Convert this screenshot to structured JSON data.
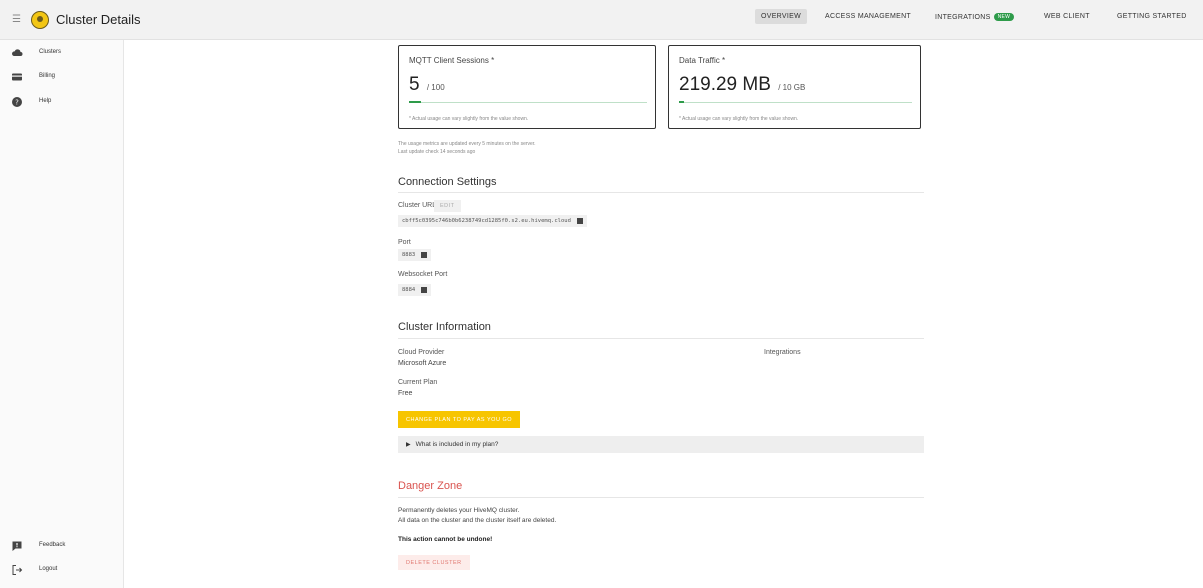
{
  "header": {
    "title": "Cluster Details",
    "nav": [
      {
        "label": "OVERVIEW",
        "active": true
      },
      {
        "label": "ACCESS MANAGEMENT",
        "active": false
      },
      {
        "label": "INTEGRATIONS",
        "badge": "NEW",
        "active": false
      },
      {
        "label": "WEB CLIENT",
        "active": false
      },
      {
        "label": "GETTING STARTED",
        "active": false
      }
    ]
  },
  "sidebar": {
    "items": [
      {
        "label": "Clusters",
        "icon": "cloud-icon"
      },
      {
        "label": "Billing",
        "icon": "credit-card-icon"
      },
      {
        "label": "Help",
        "icon": "help-icon"
      }
    ],
    "bottom": [
      {
        "label": "Feedback",
        "icon": "feedback-icon"
      },
      {
        "label": "Logout",
        "icon": "logout-icon"
      }
    ]
  },
  "usage": {
    "sessions": {
      "title": "MQTT Client Sessions *",
      "value": "5",
      "max": "/ 100",
      "fraction": 0.05,
      "note": "* Actual usage can vary slightly from the value shown."
    },
    "traffic": {
      "title": "Data Traffic *",
      "value": "219.29 MB",
      "max": "/ 10 GB",
      "fraction": 0.022,
      "note": "* Actual usage can vary slightly from the value shown."
    },
    "update_note_1": "The usage metrics are updated every 5 minutes on the server.",
    "update_note_2": "Last update check 14 seconds ago"
  },
  "connection": {
    "title": "Connection Settings",
    "url_label": "Cluster URL",
    "edit_label": "EDIT",
    "url": "cbff5c0395c746b0b6238749cd1285f0.s2.eu.hivemq.cloud",
    "port_label": "Port",
    "port": "8883",
    "ws_label": "Websocket Port",
    "ws_port": "8884"
  },
  "info": {
    "title": "Cluster Information",
    "provider_label": "Cloud Provider",
    "provider": "Microsoft Azure",
    "integrations_label": "Integrations",
    "plan_label": "Current Plan",
    "plan": "Free",
    "change_plan": "CHANGE PLAN TO PAY AS YOU GO",
    "plan_details": "What is included in my plan?"
  },
  "danger": {
    "title": "Danger Zone",
    "text1": "Permanently deletes your HiveMQ cluster.",
    "text2": "All data on the cluster and the cluster itself are deleted.",
    "warning": "This action cannot be undone!",
    "delete_label": "DELETE CLUSTER"
  },
  "colors": {
    "accent": "#f7c500",
    "success": "#2e9b4a",
    "danger": "#d9534f"
  }
}
